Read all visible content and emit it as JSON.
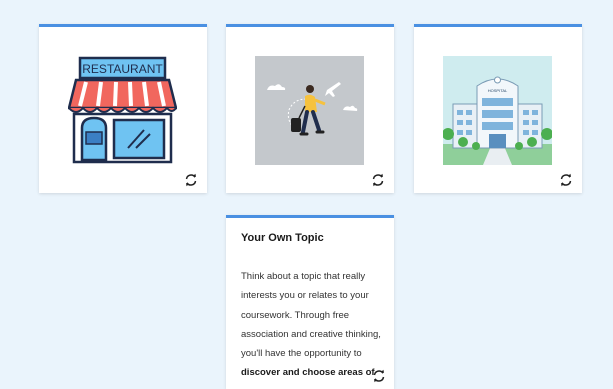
{
  "cards": [
    {
      "name": "restaurant",
      "sign_text": "RESTAURANT",
      "accent": "#4a90e2"
    },
    {
      "name": "travel",
      "accent": "#4a90e2"
    },
    {
      "name": "hospital",
      "sign_text": "HOSPITAL",
      "accent": "#4a90e2"
    }
  ],
  "topic_card": {
    "title": "Your Own Topic",
    "body_plain": "Think about a topic that really interests you or relates to your coursework. Through free association and creative thinking, you'll have the opportunity to",
    "body_bold": "discover and choose areas of"
  },
  "icons": {
    "flip": "flip-rotate-icon"
  },
  "colors": {
    "background": "#eaf4fc",
    "card_border": "#4a90e2"
  }
}
